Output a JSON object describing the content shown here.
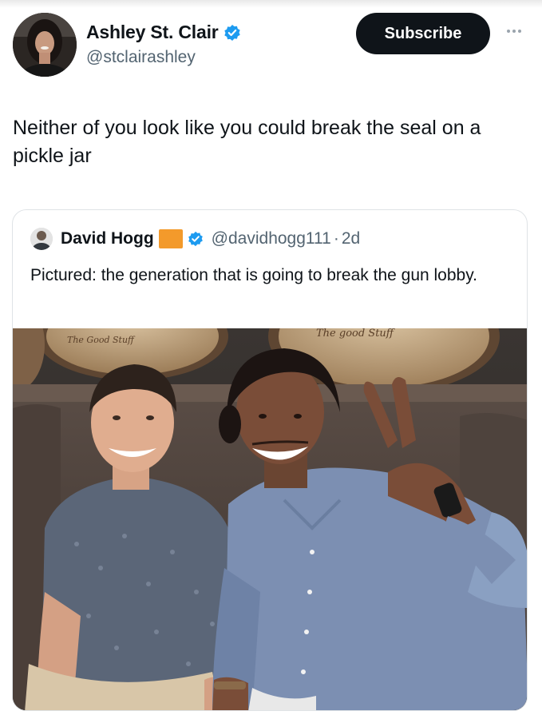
{
  "tweet": {
    "author": {
      "display_name": "Ashley St. Clair",
      "handle": "@stclairashley",
      "verified": true
    },
    "subscribe_label": "Subscribe",
    "more_icon": "more-horizontal-icon",
    "text": "Neither of you look like you could break the seal on a pickle jar"
  },
  "quoted_tweet": {
    "author": {
      "display_name": "David Hogg",
      "flag_icon": "orange-square-icon",
      "verified": true,
      "handle": "@davidhogg111",
      "separator": "·",
      "age": "2d"
    },
    "text": "Pictured: the generation that is going to break the gun lobby.",
    "media": {
      "description_icon": "photo",
      "barrel_text_left": "The Good Stuff",
      "barrel_text_right": "The good Stuff"
    }
  },
  "colors": {
    "text_primary": "#0f1419",
    "text_secondary": "#536471",
    "verified_blue": "#1d9bf0",
    "flag_orange": "#f39a2b",
    "button_bg": "#0f1419"
  }
}
